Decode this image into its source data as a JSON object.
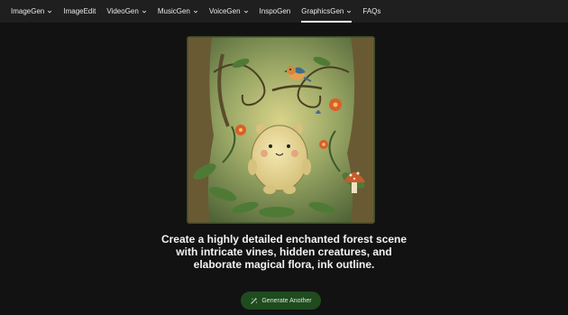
{
  "nav": {
    "items": [
      {
        "label": "ImageGen",
        "dropdown": true
      },
      {
        "label": "ImageEdit",
        "dropdown": false
      },
      {
        "label": "VideoGen",
        "dropdown": true
      },
      {
        "label": "MusicGen",
        "dropdown": true
      },
      {
        "label": "VoiceGen",
        "dropdown": true
      },
      {
        "label": "InspoGen",
        "dropdown": false
      },
      {
        "label": "GraphicsGen",
        "dropdown": true,
        "active": true
      },
      {
        "label": "FAQs",
        "dropdown": false
      }
    ]
  },
  "result": {
    "prompt": "Create a highly detailed enchanted forest scene with intricate vines, hidden creatures, and elaborate magical flora, ink outline."
  },
  "actions": {
    "generate_label": "Generate Another"
  },
  "colors": {
    "accent_button": "#1f4b1f",
    "active_underline": "#ffffff"
  },
  "icons": {
    "nav_dropdown": "chevron-down-icon",
    "generate": "magic-wand-icon"
  }
}
